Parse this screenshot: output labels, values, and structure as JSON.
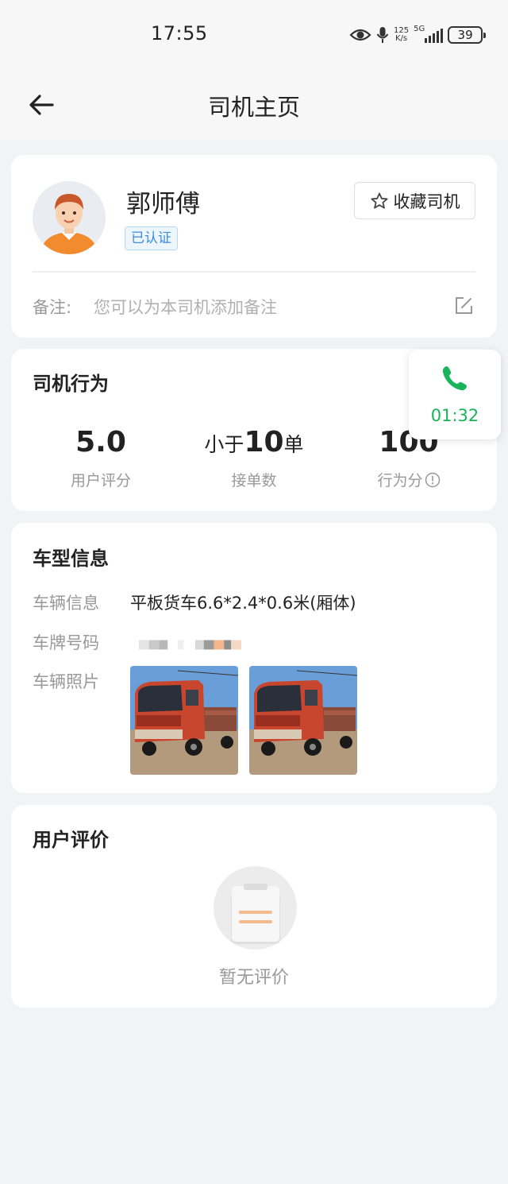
{
  "status_bar": {
    "time": "17:55",
    "net_speed_value": "125",
    "net_speed_unit": "K/s",
    "network": "5G",
    "battery": "39"
  },
  "navbar": {
    "title": "司机主页",
    "back_icon": "arrow-left-icon"
  },
  "driver": {
    "name": "郭师傅",
    "verified_badge": "已认证",
    "favorite_label": "收藏司机",
    "favorite_icon": "star-outline-icon",
    "remark_label": "备注:",
    "remark_placeholder": "您可以为本司机添加备注",
    "edit_icon": "edit-icon"
  },
  "behavior": {
    "title": "司机行为",
    "stats": [
      {
        "value": "5.0",
        "label": "用户评分"
      },
      {
        "prefix": "小于",
        "value": "10",
        "suffix": "单",
        "label": "接单数"
      },
      {
        "value": "100",
        "label": "行为分",
        "info_icon": "info-circle-icon"
      }
    ]
  },
  "call": {
    "icon": "phone-icon",
    "timer": "01:32",
    "color": "#19b35a"
  },
  "vehicle": {
    "title": "车型信息",
    "info_label": "车辆信息",
    "info_value": "平板货车6.6*2.4*0.6米(厢体)",
    "plate_label": "车牌号码",
    "plate_value_masked": "",
    "photo_label": "车辆照片",
    "photos": [
      "truck-photo-1",
      "truck-photo-2"
    ]
  },
  "reviews": {
    "title": "用户评价",
    "empty_icon": "empty-clipboard-icon",
    "empty_text": "暂无评价"
  },
  "colors": {
    "background": "#f2f3f5",
    "verified_blue": "#3b8be0",
    "accent_orange": "#f28a2e"
  }
}
